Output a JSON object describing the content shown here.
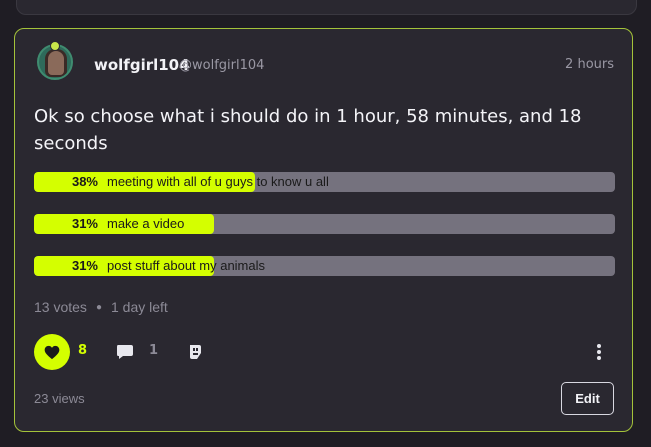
{
  "post": {
    "username": "wolfgirl104",
    "handle": "@wolfgirl104",
    "time": "2 hours",
    "title": "Ok so choose what i should do in 1 hour, 58 minutes, and 18 seconds"
  },
  "poll": {
    "options": [
      {
        "percent": "38%",
        "label": "meeting with all of u guys to know u all",
        "fraction": 0.38
      },
      {
        "percent": "31%",
        "label": "make a video",
        "fraction": 0.31
      },
      {
        "percent": "31%",
        "label": "post stuff about my animals",
        "fraction": 0.31
      }
    ],
    "votes": "13 votes",
    "time_left": "1 day left",
    "fill_color": "#d4ff00",
    "track_color": "#75727e"
  },
  "actions": {
    "like_count": "8",
    "comment_count": "1",
    "icons": [
      "heart-icon",
      "comment-icon",
      "share-icon",
      "more-vertical-icon"
    ]
  },
  "footer": {
    "views": "23 views",
    "edit_label": "Edit"
  },
  "colors": {
    "accent": "#d4ff00",
    "card_border": "#a4c33a",
    "background": "#1f1d24",
    "card": "#2a2830"
  }
}
